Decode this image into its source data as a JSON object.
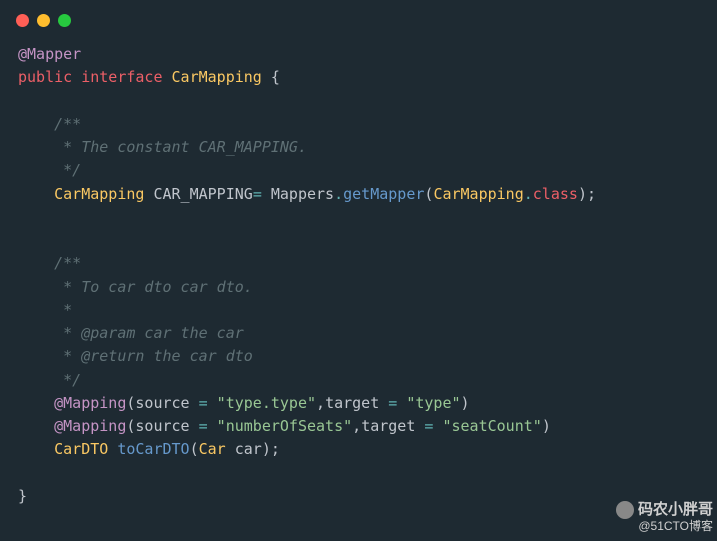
{
  "code": {
    "annotation": "@Mapper",
    "public": "public",
    "interface": "interface",
    "className": "CarMapping",
    "openBrace": "{",
    "comment1_l1": "/**",
    "comment1_l2": " * The constant CAR_MAPPING.",
    "comment1_l3": " */",
    "type1": "CarMapping",
    "constName": "CAR_MAPPING",
    "assign": "= ",
    "mappers": "Mappers",
    "dot1": ".",
    "getMapper": "getMapper",
    "lp1": "(",
    "argType": "CarMapping",
    "dot2": ".",
    "classKw": "class",
    "rp1": ")",
    "semi1": ";",
    "comment2_l1": "/**",
    "comment2_l2": " * To car dto car dto.",
    "comment2_l3": " *",
    "comment2_l4": " * @param car the car",
    "comment2_l5": " * @return the car dto",
    "comment2_l6": " */",
    "mapping1": "@Mapping",
    "lp2": "(",
    "source1": "source ",
    "eq1": "=",
    "str1": " \"type.type\"",
    "comma1": ",",
    "target1": "target ",
    "eq2": "=",
    "str2": " \"type\"",
    "rp2": ")",
    "mapping2": "@Mapping",
    "lp3": "(",
    "source2": "source ",
    "eq3": "=",
    "str3": " \"numberOfSeats\"",
    "comma2": ",",
    "target2": "target ",
    "eq4": "=",
    "str4": " \"seatCount\"",
    "rp3": ")",
    "retType": "CarDTO",
    "methodName": "toCarDTO",
    "lp4": "(",
    "paramType": "Car",
    "paramName": " car",
    "rp4": ")",
    "semi2": ";",
    "closeBrace": "}"
  },
  "watermark": {
    "main": "码农小胖哥",
    "sub": "@51CTO博客"
  }
}
